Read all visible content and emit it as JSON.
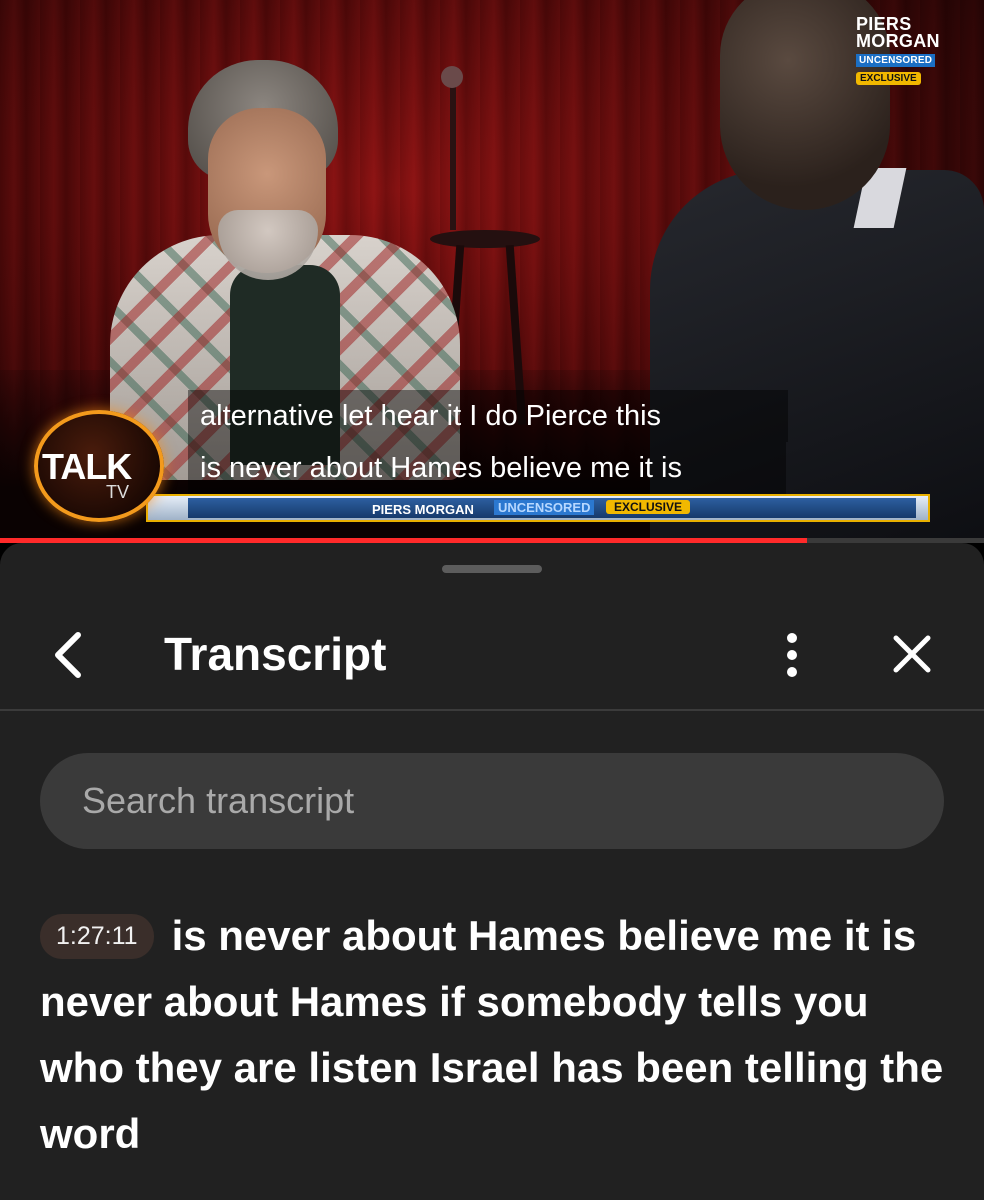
{
  "video": {
    "caption_line1": "alternative let hear it I do Pierce this",
    "caption_line2": "is never about Hames believe me it is",
    "logo": {
      "line1": "PIERS",
      "line2": "MORGAN",
      "line3": "UNCENSORED",
      "line4": "EXCLUSIVE"
    },
    "channel": {
      "talk": "TALK",
      "tv": "TV"
    },
    "banner": {
      "name": "PIERS MORGAN",
      "uncensored": "UNCENSORED",
      "exclusive": "EXCLUSIVE"
    },
    "progress": 0.82,
    "progress_color": "#ff2a2a"
  },
  "panel": {
    "title": "Transcript",
    "search_placeholder": "Search transcript",
    "segment": {
      "timestamp": "1:27:11",
      "text": "is never about Hames believe me it is never about Hames if somebody tells you who they are listen Israel has been telling the word"
    }
  },
  "icons": {
    "back": "chevron-left-icon",
    "more": "more-vertical-icon",
    "close": "close-icon"
  }
}
